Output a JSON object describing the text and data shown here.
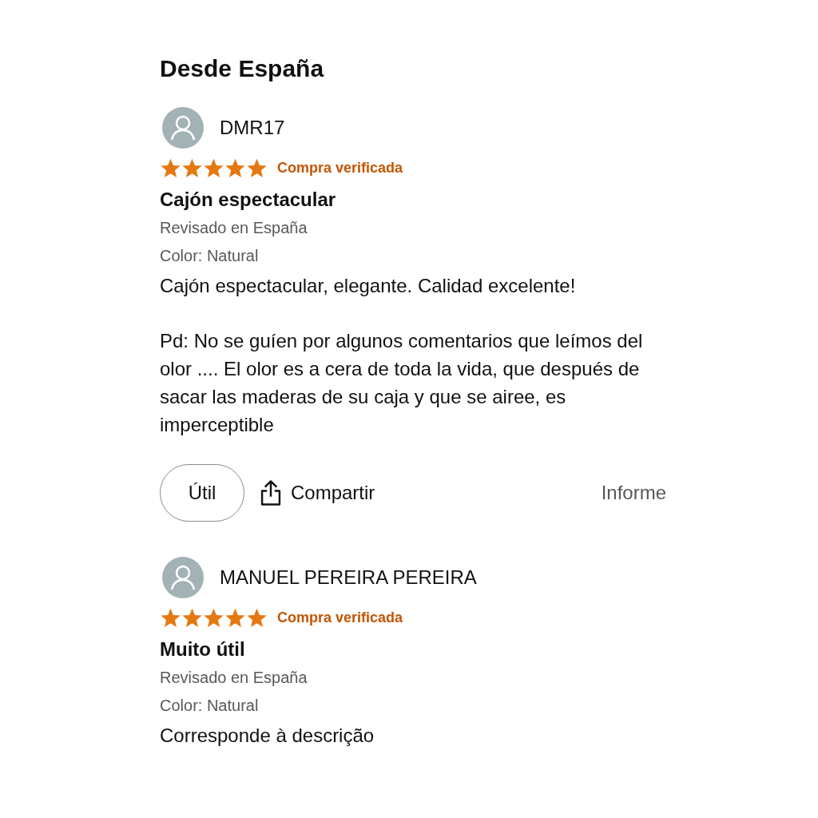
{
  "heading": "Desde España",
  "reviews": [
    {
      "author": "DMR17",
      "stars": 5,
      "badge": "Compra verificada",
      "title": "Cajón espectacular",
      "reviewed_in": "Revisado en España",
      "variant": "Color: Natural",
      "body": [
        "Cajón espectacular, elegante. Calidad excelente!",
        "Pd: No se guíen por algunos comentarios que leímos del olor .... El olor es a cera de toda la vida, que después de sacar las maderas de su caja y que se airee, es imperceptible"
      ],
      "actions": {
        "helpful": "Útil",
        "share": "Compartir",
        "report": "Informe"
      }
    },
    {
      "author": "MANUEL PEREIRA PEREIRA",
      "stars": 5,
      "badge": "Compra verificada",
      "title": "Muito útil",
      "reviewed_in": "Revisado en España",
      "variant": "Color: Natural",
      "body": [
        "Corresponde à descrição"
      ]
    }
  ]
}
